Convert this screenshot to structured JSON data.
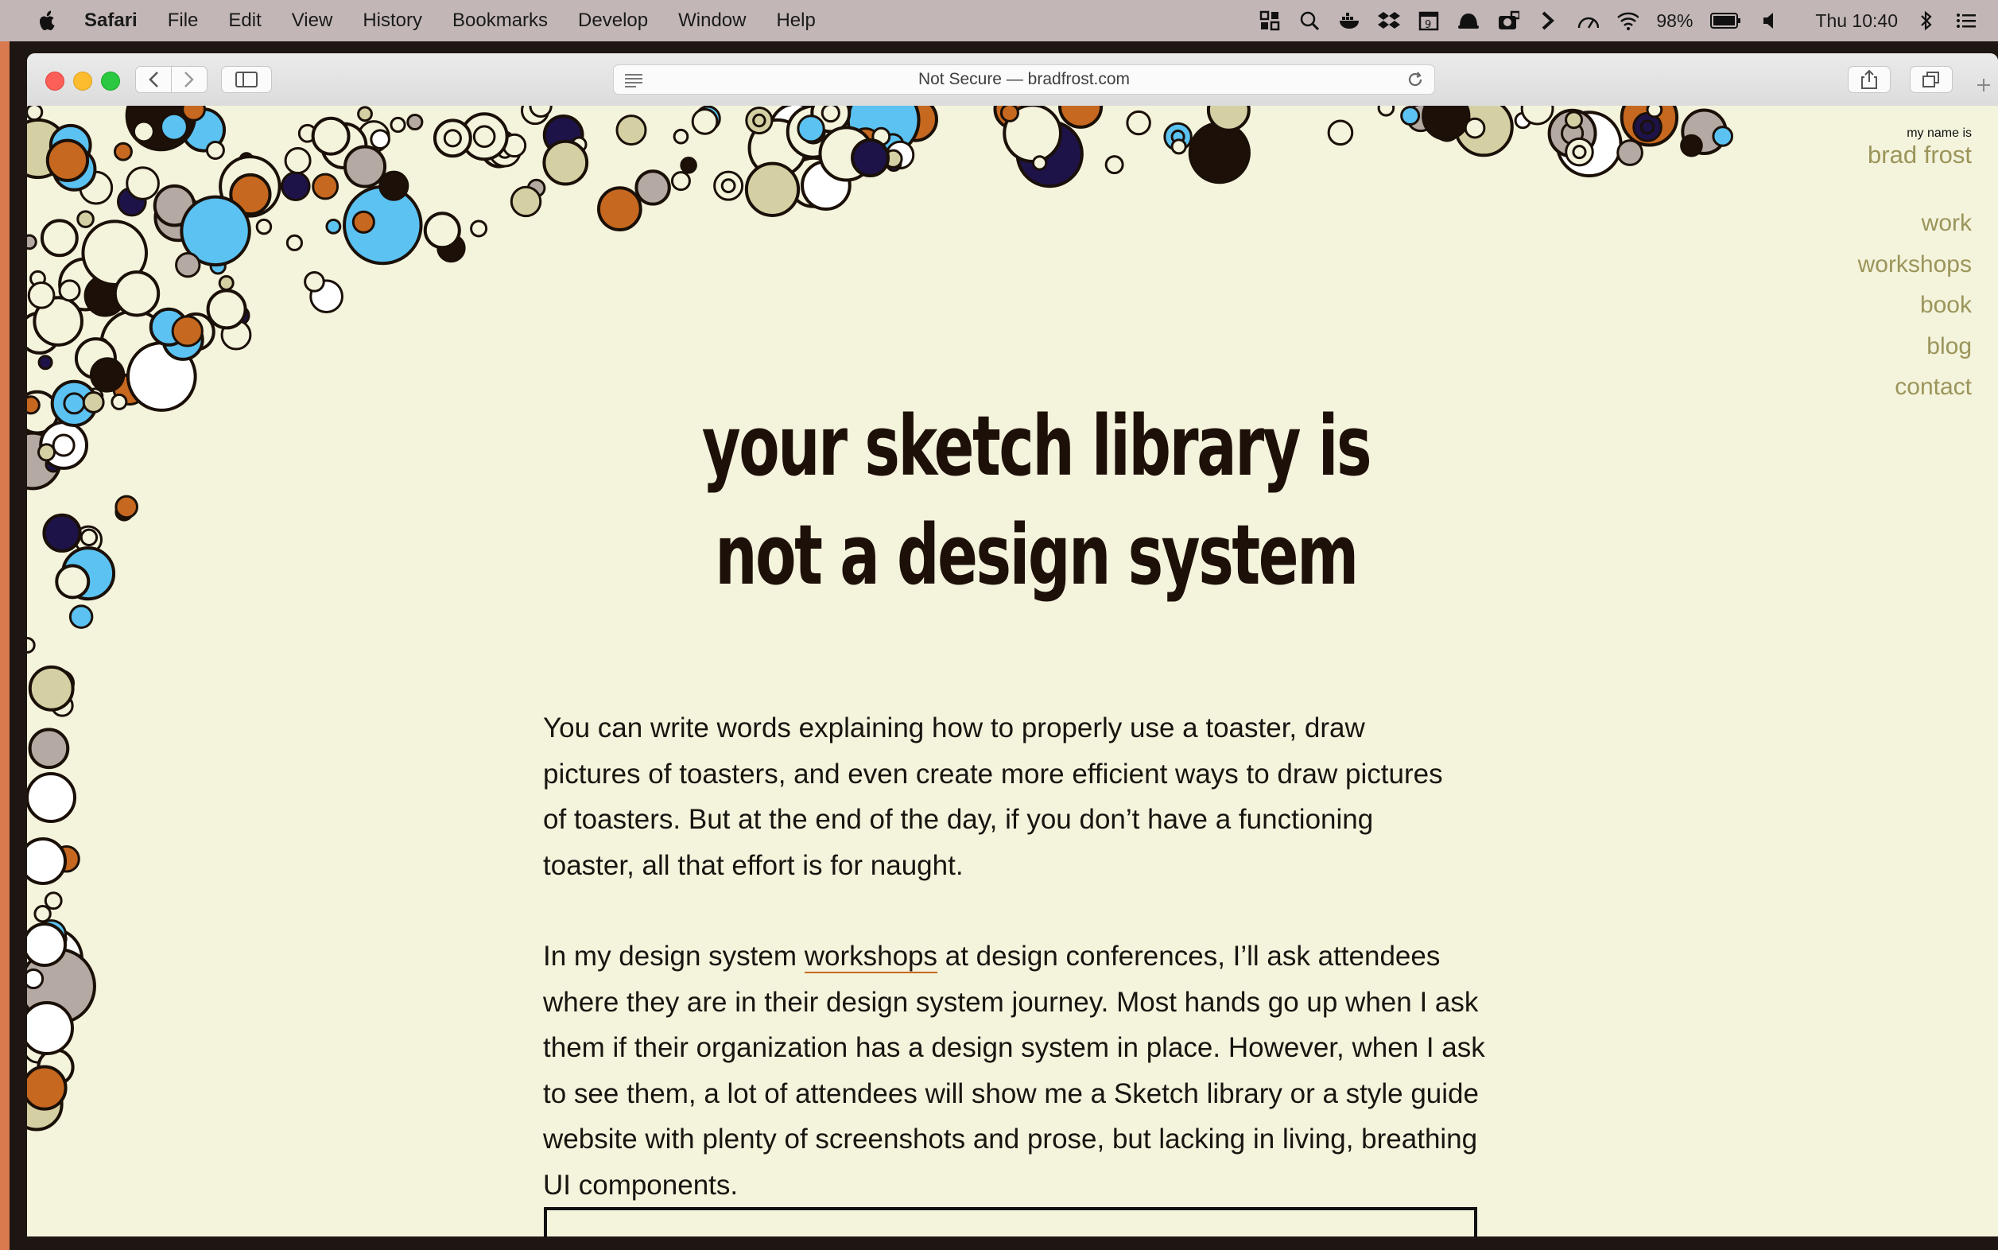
{
  "menubar": {
    "app_name": "Safari",
    "items": [
      "File",
      "Edit",
      "View",
      "History",
      "Bookmarks",
      "Develop",
      "Window",
      "Help"
    ],
    "battery_percent": "98%",
    "clock": "Thu 10:40"
  },
  "browser": {
    "address": "Not Secure — bradfrost.com"
  },
  "site": {
    "name_prefix": "my name is",
    "name": "brad frost",
    "nav": [
      "work",
      "workshops",
      "book",
      "blog",
      "contact"
    ]
  },
  "article": {
    "title_line1": "your sketch library is",
    "title_line2": "not a design system",
    "p1": "You can write words explaining how to properly use a toaster, draw pictures of toasters, and even create more efficient ways to draw pictures of toasters. But at the end of the day, if you don’t have a functioning toaster, all that effort is for naught.",
    "p2_before": "In my design system ",
    "p2_link": "workshops",
    "p2_after": " at design conferences, I’ll ask attendees where they are in their design system journey. Most hands go up when I ask them if their organization has a design system in place. However, when I ask to see them, a lot of attendees will show me a Sketch library or a style guide website with plenty of screenshots and prose, but lacking in living, breathing UI components."
  },
  "colors": {
    "page_bg": "#f4f3dc",
    "nav_text": "#9b955b",
    "headline": "#1d1009",
    "link_underline": "#c6681f",
    "bubble_palette": [
      "#f4f3dc",
      "#c6681f",
      "#1d1348",
      "#b4a9a3",
      "#5bc2f2",
      "#1d1009",
      "#d4d0a4",
      "#ffffff"
    ]
  }
}
